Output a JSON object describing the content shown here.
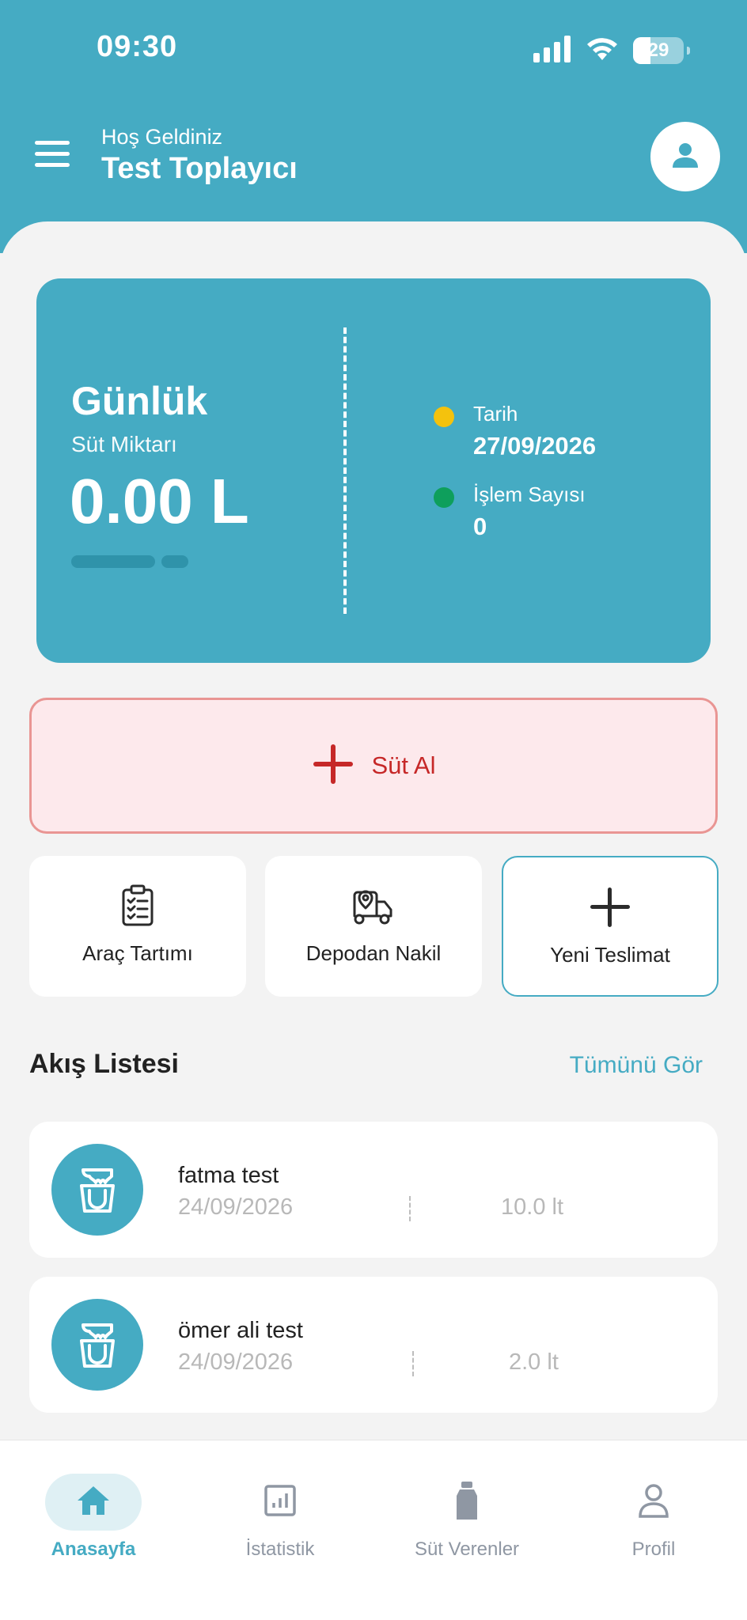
{
  "status_bar": {
    "time": "09:30",
    "battery": "29",
    "icons": [
      "signal-icon",
      "wifi-icon",
      "battery-icon"
    ]
  },
  "header": {
    "welcome": "Hoş Geldiniz",
    "user_name": "Test Toplayıcı",
    "menu_icon": "menu-icon",
    "avatar_icon": "person-icon"
  },
  "daily_card": {
    "title": "Günlük",
    "subtitle": "Süt Miktarı",
    "amount": "0.00 L",
    "date_label": "Tarih",
    "date_value": "27/09/2026",
    "count_label": "İşlem Sayısı",
    "count_value": "0"
  },
  "primary_action": {
    "label": "Süt Al",
    "icon": "plus-icon"
  },
  "actions": [
    {
      "label": "Araç Tartımı",
      "icon": "clipboard-check-icon"
    },
    {
      "label": "Depodan Nakil",
      "icon": "delivery-truck-icon"
    },
    {
      "label": "Yeni Teslimat",
      "icon": "plus-icon"
    }
  ],
  "flow": {
    "title": "Akış Listesi",
    "see_all": "Tümünü Gör",
    "items": [
      {
        "name": "fatma test",
        "date": "24/09/2026",
        "amount": "10.0 lt"
      },
      {
        "name": "ömer ali test",
        "date": "24/09/2026",
        "amount": "2.0 lt"
      }
    ]
  },
  "bottom_nav": {
    "items": [
      {
        "label": "Anasayfa",
        "icon": "home-icon",
        "active": true
      },
      {
        "label": "İstatistik",
        "icon": "chart-icon",
        "active": false
      },
      {
        "label": "Süt Verenler",
        "icon": "milk-bottle-icon",
        "active": false
      },
      {
        "label": "Profil",
        "icon": "person-icon",
        "active": false
      }
    ]
  },
  "colors": {
    "primary": "#45abc3",
    "danger": "#c62828",
    "danger_bg": "#fde9ec",
    "background": "#f3f3f3",
    "yellow_dot": "#f4c20d",
    "green_dot": "#0e9f5c"
  }
}
